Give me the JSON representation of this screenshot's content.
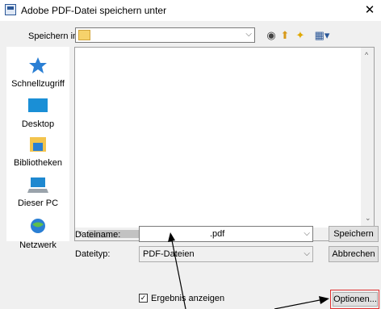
{
  "window": {
    "title": "Adobe PDF-Datei speichern unter",
    "close_glyph": "✕"
  },
  "look_in": {
    "label": "Speichern in:",
    "value": "",
    "arrow": "⌵"
  },
  "toolbar": {
    "back": "◉",
    "up": "⬆",
    "newfolder": "✦",
    "view": "▦▾"
  },
  "places": [
    {
      "label": "Schnellzugriff",
      "icon": "star-icon"
    },
    {
      "label": "Desktop",
      "icon": "desktop-icon"
    },
    {
      "label": "Bibliotheken",
      "icon": "library-icon"
    },
    {
      "label": "Dieser PC",
      "icon": "computer-icon"
    },
    {
      "label": "Netzwerk",
      "icon": "network-icon"
    }
  ],
  "scroll": {
    "up": "^",
    "down": "⌄",
    "left": "<",
    "right": ">"
  },
  "form": {
    "filename_label": "Dateiname:",
    "filename_value": ".pdf",
    "filetype_label": "Dateityp:",
    "filetype_value": "PDF-Dateien",
    "combo_arrow": "⌵",
    "save": "Speichern",
    "cancel": "Abbrechen",
    "show_result_label": "Ergebnis anzeigen",
    "show_result_checked": "✓",
    "options": "Optionen..."
  }
}
